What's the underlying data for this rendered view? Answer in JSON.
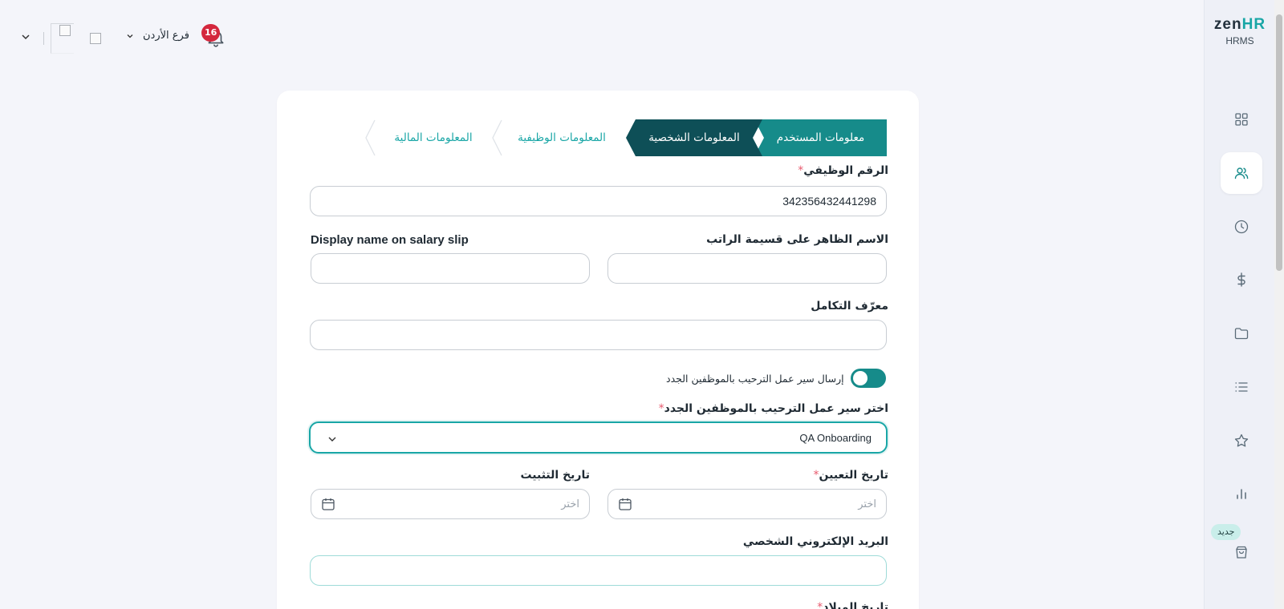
{
  "app": {
    "logo_brand": "zen",
    "logo_brand_hr": "HR",
    "logo_sub": "HRMS",
    "new_badge": "جديد"
  },
  "sidebar": {
    "items": [
      {
        "icon": "grid-icon"
      },
      {
        "icon": "users-icon",
        "active": true
      },
      {
        "icon": "clock-icon"
      },
      {
        "icon": "dollar-icon"
      },
      {
        "icon": "folder-icon"
      },
      {
        "icon": "list-icon"
      },
      {
        "icon": "star-icon"
      },
      {
        "icon": "bar-chart-icon"
      },
      {
        "icon": "shopping-bag-icon"
      }
    ]
  },
  "topbar": {
    "branch": "فرع الأردن",
    "notification_count": "16"
  },
  "stepper": {
    "steps": [
      {
        "label": "معلومات المستخدم",
        "state": "completed"
      },
      {
        "label": "المعلومات الشخصية",
        "state": "current"
      },
      {
        "label": "المعلومات الوظيفية",
        "state": "upcoming"
      },
      {
        "label": "المعلومات المالية",
        "state": "upcoming"
      }
    ]
  },
  "form": {
    "employee_id": {
      "label": "الرقم الوظيفي",
      "required": "*",
      "value": "342356432441298"
    },
    "salary_slip_name_ar": {
      "label": "الاسم الظاهر على قسيمة الراتب",
      "value": ""
    },
    "salary_slip_name_en": {
      "label": "Display name on salary slip",
      "value": ""
    },
    "integration_id": {
      "label": "معرّف التكامل",
      "value": ""
    },
    "onboarding_toggle": {
      "label": "إرسال سير عمل الترحيب بالموظفين الجدد",
      "on": true
    },
    "onboarding_workflow": {
      "label": "اختر سير عمل الترحيب بالموظفين الجدد",
      "required": "*",
      "value": "QA Onboarding"
    },
    "hire_date": {
      "label": "تاريخ التعيين",
      "required": "*",
      "placeholder": "اختر"
    },
    "confirmation_date": {
      "label": "تاريخ التثبيت",
      "placeholder": "اختر"
    },
    "personal_email": {
      "label": "البريد الإلكتروني الشخصي",
      "value": ""
    },
    "birth_date": {
      "label": "تاريخ الميلاد",
      "required": "*"
    }
  },
  "colors": {
    "accent": "#19a6a6",
    "step_completed": "#168b8a",
    "step_current": "#0e4f57",
    "badge_red": "#d4273d"
  }
}
